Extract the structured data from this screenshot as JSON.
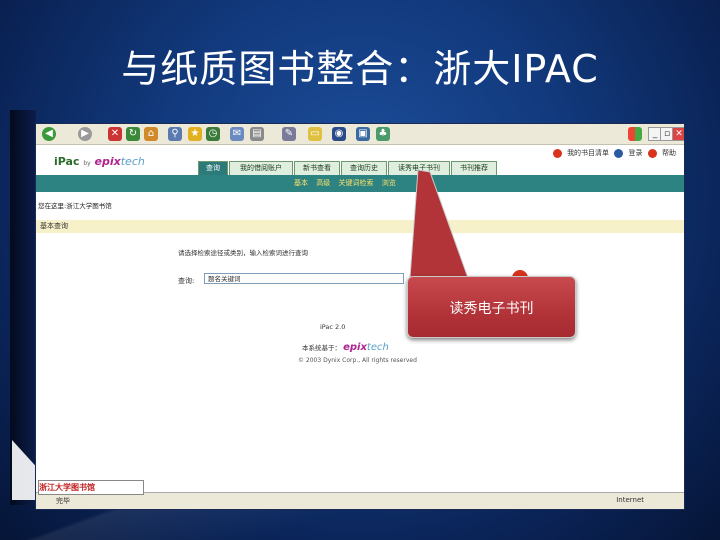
{
  "slide": {
    "title": "与纸质图书整合：浙大IPAC",
    "bottom_banner": "浙江大学图书馆"
  },
  "browser": {
    "toolbar_icons": [
      "back-icon",
      "forward-icon",
      "stop-icon",
      "refresh-icon",
      "home-icon",
      "search-icon",
      "favorites-icon",
      "history-icon",
      "mail-icon",
      "print-icon",
      "edit-icon",
      "folder-icon",
      "messenger-icon",
      "windows-flag-icon"
    ],
    "toplinks": {
      "my_list": "我的书目清单",
      "login": "登录",
      "help": "帮助"
    },
    "logo": {
      "ipac": "iPac",
      "by": "by",
      "epix": "epix",
      "tech": "tech"
    },
    "tabs": [
      {
        "label": "查询",
        "active": true
      },
      {
        "label": "我的借阅账户",
        "active": false
      },
      {
        "label": "新书查看",
        "active": false
      },
      {
        "label": "查询历史",
        "active": false
      },
      {
        "label": "读秀电子书刊",
        "active": false
      },
      {
        "label": "书刊推荐",
        "active": false
      }
    ],
    "subnav": [
      "基本",
      "高级",
      "关键词检索",
      "浏览"
    ],
    "breadcrumb": "您在这里:浙江大学图书馆",
    "section_title": "基本查询",
    "intro_text": "请选择检索途径或类别，输入检索词进行查询",
    "query_label": "查询:",
    "query_value": "题名关键词",
    "footer_version": "iPac 2.0",
    "footer_powered": "本系统基于：",
    "footer_epix": "epix",
    "footer_tech": "tech",
    "footer_copyright": "© 2003 Dynix Corp., All rights reserved",
    "status_left": "完毕",
    "status_right": "Internet"
  },
  "callout": {
    "text": "读秀电子书刊",
    "color": "#b23338"
  }
}
